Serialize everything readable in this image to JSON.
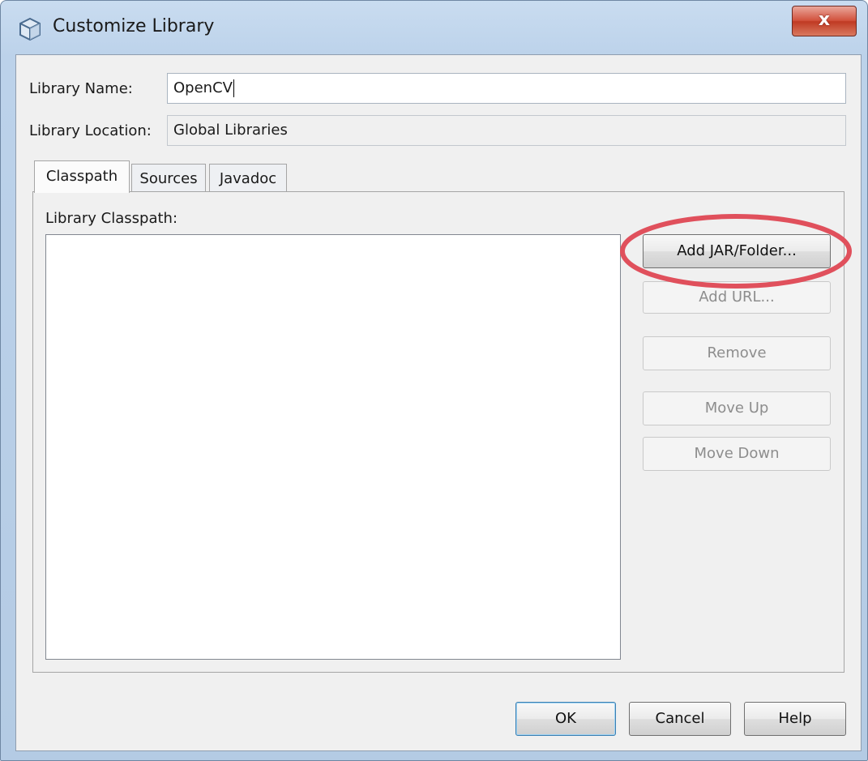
{
  "window": {
    "title": "Customize Library",
    "close_label": "x"
  },
  "fields": {
    "name_label": "Library Name:",
    "name_value": "OpenCV",
    "location_label": "Library Location:",
    "location_value": "Global Libraries"
  },
  "tabs": [
    {
      "label": "Classpath"
    },
    {
      "label": "Sources"
    },
    {
      "label": "Javadoc"
    }
  ],
  "panel": {
    "list_label": "Library Classpath:"
  },
  "buttons": {
    "add_jar": "Add JAR/Folder...",
    "add_url": "Add URL...",
    "remove": "Remove",
    "move_up": "Move Up",
    "move_down": "Move Down"
  },
  "footer": {
    "ok": "OK",
    "cancel": "Cancel",
    "help": "Help"
  },
  "colors": {
    "highlight_ring": "#e0505c",
    "title_gradient_top": "#c9dcf0",
    "close_button": "#c8432d"
  },
  "icons": {
    "app_icon": "cube-icon",
    "close_icon": "close-icon"
  }
}
